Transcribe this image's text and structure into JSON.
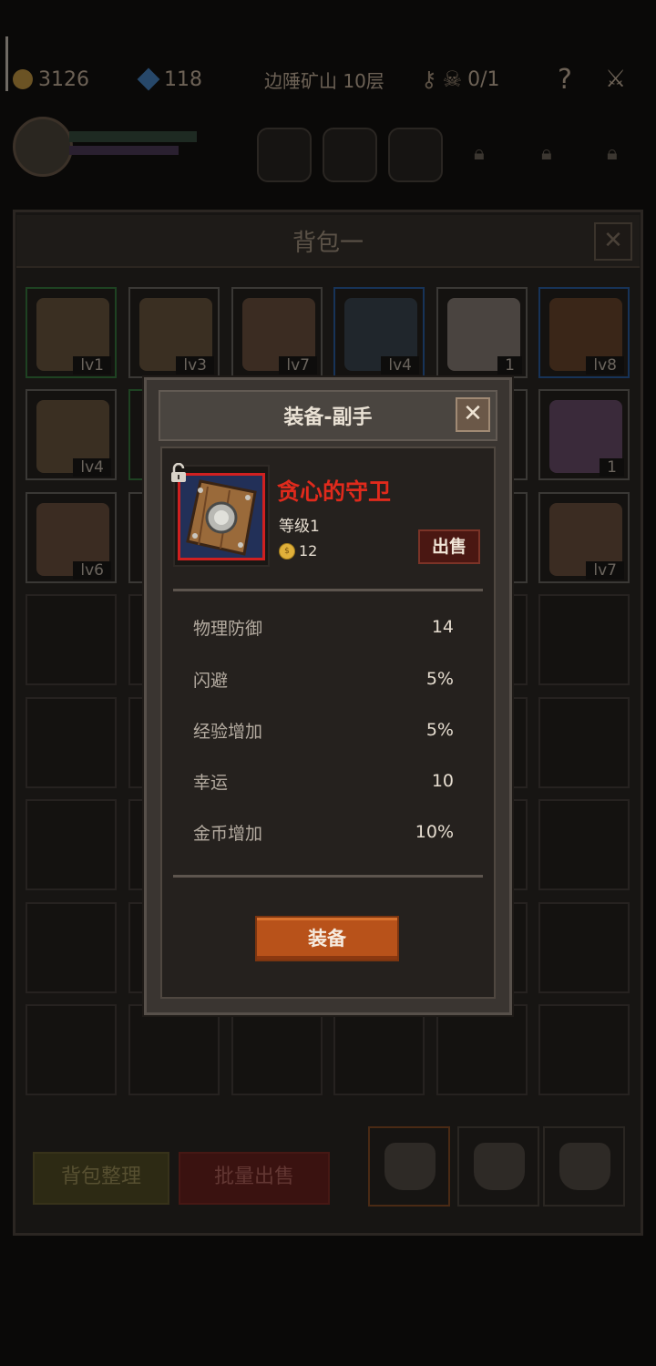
{
  "topbar": {
    "gold": "3126",
    "gems": "118",
    "location": "边陲矿山 10层",
    "keys": "0/1",
    "help_glyph": "?",
    "icons": [
      "coin-icon",
      "gem-icon",
      "key-icon",
      "skull-icon",
      "help-icon",
      "sword-icon"
    ]
  },
  "bag": {
    "title": "背包一",
    "close_glyph": "✕",
    "cells": [
      {
        "label": "lv1",
        "icon": "pickaxe-icon",
        "rarity": "green"
      },
      {
        "label": "lv3",
        "icon": "pickaxe-icon",
        "rarity": "gray"
      },
      {
        "label": "lv7",
        "icon": "glove-icon",
        "rarity": "gray"
      },
      {
        "label": "lv4",
        "icon": "pistol-icon",
        "rarity": "blue"
      },
      {
        "label": "1",
        "icon": "cake-icon",
        "rarity": "gray"
      },
      {
        "label": "lv8",
        "icon": "boots-icon",
        "rarity": "blue"
      },
      {
        "label": "lv4",
        "icon": "pickaxe-icon",
        "rarity": "gray"
      },
      {
        "label": "",
        "icon": "",
        "rarity": "green"
      },
      {
        "label": "",
        "icon": "",
        "rarity": "gray"
      },
      {
        "label": "",
        "icon": "",
        "rarity": "gray"
      },
      {
        "label": "",
        "icon": "",
        "rarity": "gray"
      },
      {
        "label": "1",
        "icon": "potion-icon",
        "rarity": "gray"
      },
      {
        "label": "lv6",
        "icon": "glove-icon",
        "rarity": "gray"
      },
      {
        "label": "",
        "icon": "",
        "rarity": "gray"
      },
      {
        "label": "",
        "icon": "",
        "rarity": "gray"
      },
      {
        "label": "",
        "icon": "",
        "rarity": "gray"
      },
      {
        "label": "",
        "icon": "",
        "rarity": "gray"
      },
      {
        "label": "lv7",
        "icon": "glove-icon",
        "rarity": "gray"
      }
    ],
    "sort_button": "背包整理",
    "bulk_sell_button": "批量出售"
  },
  "modal": {
    "title": "装备-副手",
    "close_glyph": "✕",
    "item_name": "贪心的守卫",
    "item_level": "等级1",
    "coin_glyph": "$",
    "price": "12",
    "sell_button": "出售",
    "stats": [
      {
        "label": "物理防御",
        "value": "14"
      },
      {
        "label": "闪避",
        "value": "5%"
      },
      {
        "label": "经验增加",
        "value": "5%"
      },
      {
        "label": "幸运",
        "value": "10"
      },
      {
        "label": "金币增加",
        "value": "10%"
      }
    ],
    "equip_button": "装备"
  },
  "colors": {
    "item_name": "#e02a1c",
    "equip_button": "#b8521a",
    "sell_button": "#4a1712",
    "rarity_highlight": "#d02020"
  }
}
